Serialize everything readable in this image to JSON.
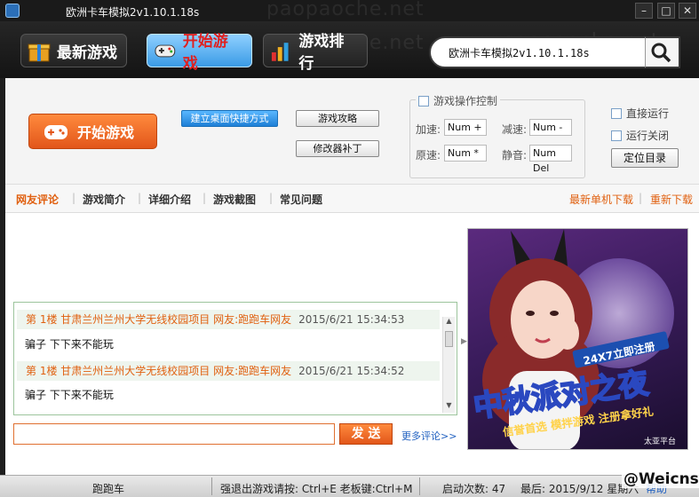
{
  "window": {
    "title": "欧洲卡车模拟2v1.10.1.18s"
  },
  "watermark": "paopaoche.net",
  "nav": [
    {
      "label": "最新游戏"
    },
    {
      "label": "开始游戏"
    },
    {
      "label": "游戏排行"
    }
  ],
  "search": {
    "value": "欧洲卡车模拟2v1.10.1.18s"
  },
  "panel": {
    "start_label": "开始游戏",
    "shortcut_label": "建立桌面快捷方式",
    "guide_label": "游戏攻略",
    "trainer_label": "修改器补丁",
    "control": {
      "title": "游戏操作控制",
      "accel_label": "加速:",
      "accel_key": "Num +",
      "decel_label": "减速:",
      "decel_key": "Num -",
      "normal_label": "原速:",
      "normal_key": "Num *",
      "mute_label": "静音:",
      "mute_key": "Num Del"
    },
    "direct_run_label": "直接运行",
    "run_close_label": "运行关闭",
    "locate_label": "定位目录"
  },
  "tabs": [
    "网友评论",
    "游戏简介",
    "详细介绍",
    "游戏截图",
    "常见问题"
  ],
  "downloads": {
    "latest": "最新单机下载",
    "redownload": "重新下载"
  },
  "comments": [
    {
      "header": "第 1楼 甘肃兰州兰州大学无线校园项目 网友:跑跑车网友",
      "time": "2015/6/21 15:34:53",
      "body": "骗子 下下来不能玩"
    },
    {
      "header": "第 1楼 甘肃兰州兰州大学无线校园项目 网友:跑跑车网友",
      "time": "2015/6/21 15:34:52",
      "body": "骗子 下下来不能玩"
    }
  ],
  "comment_box": {
    "send_label": "发 送",
    "more_label": "更多评论>>"
  },
  "ad": {
    "tag": "24X7立即注册",
    "headline": "中秋派对之夜",
    "slogan": "信誉首选 模拌游戏 注册拿好礼",
    "brand": "太亚平台"
  },
  "status": {
    "brand": "跑跑车",
    "hotkeys": "强退出游戏请按: Ctrl+E 老板键:Ctrl+M",
    "launches": "启动次数: 47",
    "last": "最后: 2015/9/12 星期六",
    "help": "帮助",
    "corner": "@Weicns"
  },
  "colors": {
    "accent_orange": "#e06010",
    "nav_active": "#3a9be6",
    "header_bg": "#1a1a1a"
  }
}
